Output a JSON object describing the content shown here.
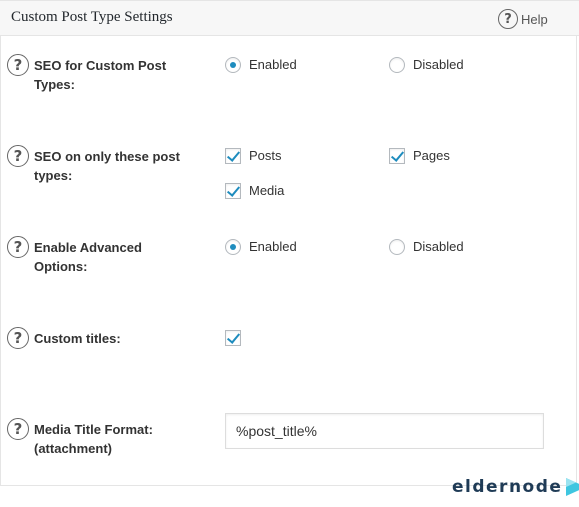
{
  "header": {
    "title": "Custom Post Type Settings",
    "help_label": "Help"
  },
  "settings": {
    "seo_custom_post_types": {
      "label": "SEO for Custom Post Types:",
      "options": [
        {
          "label": "Enabled",
          "selected": true
        },
        {
          "label": "Disabled",
          "selected": false
        }
      ]
    },
    "seo_only_these_types": {
      "label": "SEO on only these post types:",
      "options": [
        {
          "label": "Posts",
          "checked": true
        },
        {
          "label": "Pages",
          "checked": true
        },
        {
          "label": "Media",
          "checked": true
        }
      ]
    },
    "enable_advanced_options": {
      "label": "Enable Advanced Options:",
      "options": [
        {
          "label": "Enabled",
          "selected": true
        },
        {
          "label": "Disabled",
          "selected": false
        }
      ]
    },
    "custom_titles": {
      "label": "Custom titles:",
      "checked": true
    },
    "media_title_format": {
      "label": "Media Title Format: (attachment)",
      "value": "%post_title%"
    }
  },
  "watermark": {
    "text": "eldernode",
    "accent": "#3ec6e0",
    "text_color": "#1f3b56"
  },
  "colors": {
    "accent": "#1e8cbe",
    "header_bg": "#f7f7f7",
    "border": "#e5e5e5"
  }
}
